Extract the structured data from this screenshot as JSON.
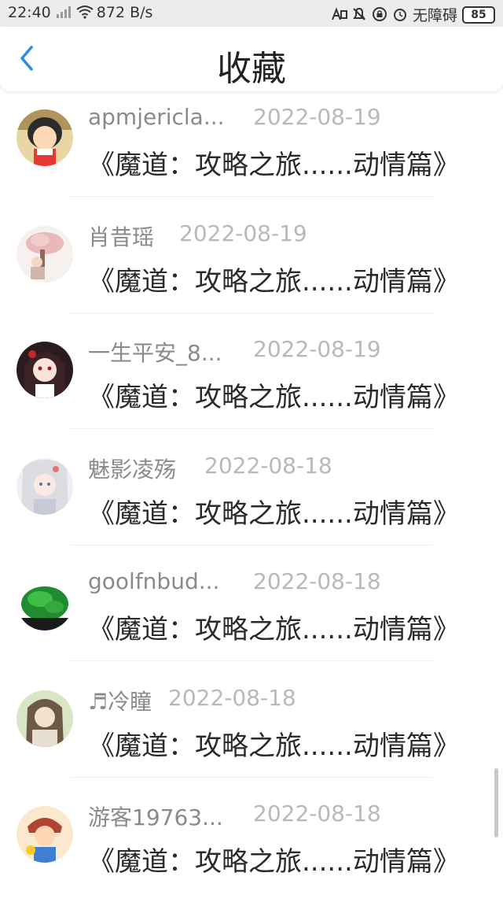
{
  "status_bar": {
    "time": "22:40",
    "network_speed": "872 B/s",
    "accessibility": "无障碍",
    "battery": "85"
  },
  "header": {
    "title": "收藏"
  },
  "items": [
    {
      "name": "apmjericla...",
      "date": "2022-08-19",
      "content": "《魔道：攻略之旅......动情篇》"
    },
    {
      "name": "肖昔瑶",
      "date": "2022-08-19",
      "content": "《魔道：攻略之旅......动情篇》"
    },
    {
      "name": "一生平安_8...",
      "date": "2022-08-19",
      "content": "《魔道：攻略之旅......动情篇》"
    },
    {
      "name": "魅影凌殇",
      "date": "2022-08-18",
      "content": "《魔道：攻略之旅......动情篇》"
    },
    {
      "name": "goolfnbud...",
      "date": "2022-08-18",
      "content": "《魔道：攻略之旅......动情篇》"
    },
    {
      "name": "♬冷瞳",
      "date": "2022-08-18",
      "content": "《魔道：攻略之旅......动情篇》"
    },
    {
      "name": "游客19763...",
      "date": "2022-08-18",
      "content": "《魔道：攻略之旅......动情篇》"
    }
  ],
  "colors": {
    "accent": "#2b8de6",
    "name_text": "#8a8a8a",
    "date_text": "#b9b9b9",
    "content_text": "#2a2a2a"
  }
}
